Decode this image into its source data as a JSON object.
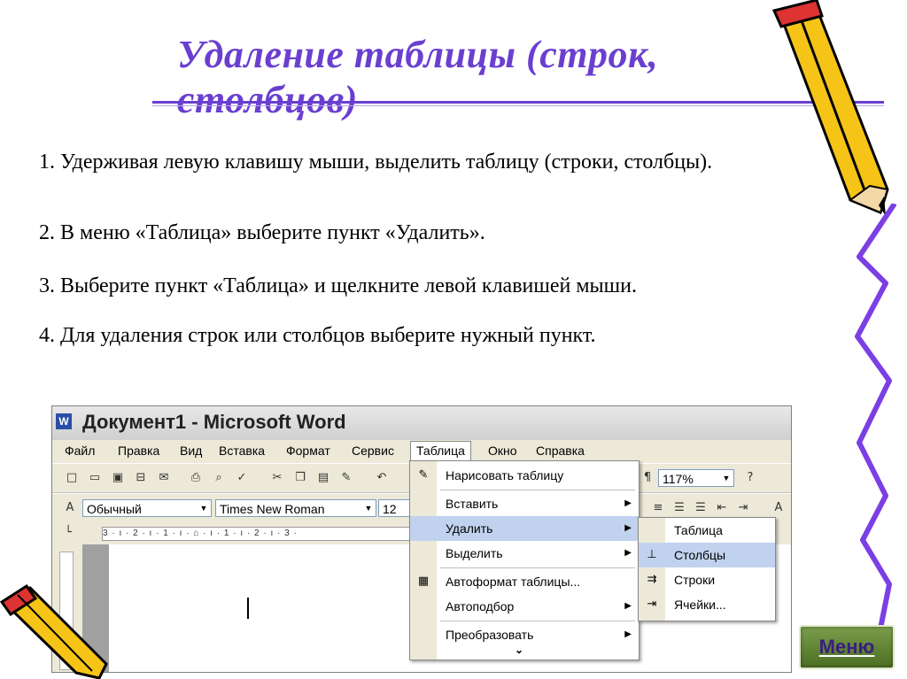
{
  "title": "Удаление таблицы (строк, столбцов)",
  "steps": [
    "1. Удерживая левую клавишу мыши, выделить таблицу (строки, столбцы).",
    "2. В меню «Таблица» выберите пункт «Удалить».",
    "3. Выберите пункт «Таблица» и щелкните левой клавишей мыши.",
    "4. Для удаления строк или столбцов выберите нужный пункт."
  ],
  "word_window": {
    "title": "Документ1 - Microsoft Word",
    "menubar": [
      "Файл",
      "Правка",
      "Вид",
      "Вставка",
      "Формат",
      "Сервис",
      "Таблица",
      "Окно",
      "Справка"
    ],
    "zoom": "117%",
    "style_value": "Обычный",
    "font_value": "Times New Roman",
    "size_value": "12",
    "ruler_text": "3 · ı · 2 · ı · 1 · ı · ⌂ · ı · 1 · ı · 2 · ı · 3 ·"
  },
  "table_menu": {
    "items": [
      {
        "label": "Нарисовать таблицу",
        "icon": "pencil-icon",
        "submenu": false
      },
      {
        "label": "Вставить",
        "icon": "",
        "submenu": true
      },
      {
        "label": "Удалить",
        "icon": "",
        "submenu": true,
        "highlighted": true
      },
      {
        "label": "Выделить",
        "icon": "",
        "submenu": true
      },
      {
        "label": "Автоформат таблицы...",
        "icon": "autoformat-icon",
        "submenu": false
      },
      {
        "label": "Автоподбор",
        "icon": "",
        "submenu": true
      },
      {
        "label": "Преобразовать",
        "icon": "",
        "submenu": true
      }
    ],
    "expand_glyph": "⌄"
  },
  "delete_submenu": {
    "items": [
      {
        "label": "Таблица",
        "icon": "table-icon"
      },
      {
        "label": "Столбцы",
        "icon": "delete-columns-icon",
        "highlighted": true
      },
      {
        "label": "Строки",
        "icon": "delete-rows-icon"
      },
      {
        "label": "Ячейки...",
        "icon": "delete-cells-icon"
      }
    ]
  },
  "menu_button": "Меню",
  "colors": {
    "title": "#6a3fd0",
    "highlight": "#c1d2ee",
    "decor_line": "#7b3fe4",
    "pencil_yellow": "#f6c417"
  }
}
